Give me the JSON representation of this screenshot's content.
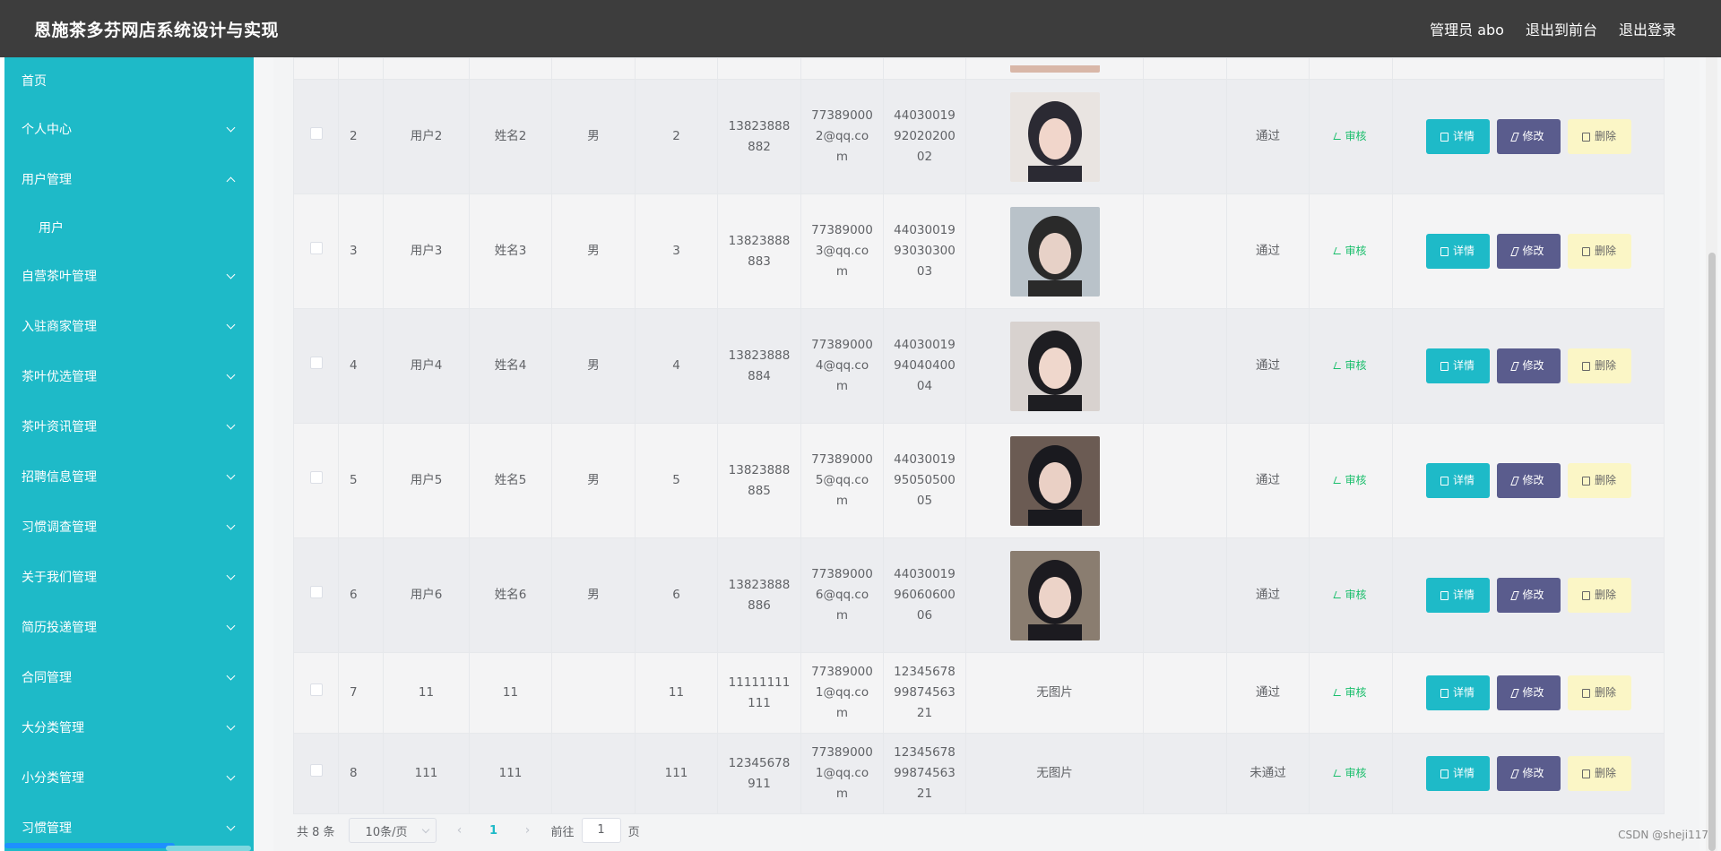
{
  "header": {
    "title": "恩施茶多芬网店系统设计与实现",
    "admin": "管理员 abo",
    "to_front": "退出到前台",
    "logout": "退出登录"
  },
  "sidebar": {
    "items": [
      {
        "label": "首页",
        "icon": "none"
      },
      {
        "label": "个人中心",
        "icon": "chevron-down-icon"
      },
      {
        "label": "用户管理",
        "icon": "chevron-up-icon"
      },
      {
        "label": "用户",
        "icon": "none"
      },
      {
        "label": "自营茶叶管理",
        "icon": "chevron-down-icon"
      },
      {
        "label": "入驻商家管理",
        "icon": "chevron-down-icon"
      },
      {
        "label": "茶叶优选管理",
        "icon": "chevron-down-icon"
      },
      {
        "label": "茶叶资讯管理",
        "icon": "chevron-down-icon"
      },
      {
        "label": "招聘信息管理",
        "icon": "chevron-down-icon"
      },
      {
        "label": "习惯调查管理",
        "icon": "chevron-down-icon"
      },
      {
        "label": "关于我们管理",
        "icon": "chevron-down-icon"
      },
      {
        "label": "简历投递管理",
        "icon": "chevron-down-icon"
      },
      {
        "label": "合同管理",
        "icon": "chevron-down-icon"
      },
      {
        "label": "大分类管理",
        "icon": "chevron-down-icon"
      },
      {
        "label": "小分类管理",
        "icon": "chevron-down-icon"
      },
      {
        "label": "习惯管理",
        "icon": "chevron-down-icon"
      }
    ]
  },
  "table": {
    "rows": [
      {
        "no": "2",
        "account": "用户2",
        "name": "姓名2",
        "gender": "男",
        "age": "2",
        "phone": [
          "13823888",
          "882"
        ],
        "email": [
          "77389000",
          "2@qq.co",
          "m"
        ],
        "idcard": [
          "44030019",
          "92020200",
          "02"
        ],
        "photo": "portrait-2",
        "status": "通过"
      },
      {
        "no": "3",
        "account": "用户3",
        "name": "姓名3",
        "gender": "男",
        "age": "3",
        "phone": [
          "13823888",
          "883"
        ],
        "email": [
          "77389000",
          "3@qq.co",
          "m"
        ],
        "idcard": [
          "44030019",
          "93030300",
          "03"
        ],
        "photo": "portrait-3",
        "status": "通过"
      },
      {
        "no": "4",
        "account": "用户4",
        "name": "姓名4",
        "gender": "男",
        "age": "4",
        "phone": [
          "13823888",
          "884"
        ],
        "email": [
          "77389000",
          "4@qq.co",
          "m"
        ],
        "idcard": [
          "44030019",
          "94040400",
          "04"
        ],
        "photo": "portrait-4",
        "status": "通过"
      },
      {
        "no": "5",
        "account": "用户5",
        "name": "姓名5",
        "gender": "男",
        "age": "5",
        "phone": [
          "13823888",
          "885"
        ],
        "email": [
          "77389000",
          "5@qq.co",
          "m"
        ],
        "idcard": [
          "44030019",
          "95050500",
          "05"
        ],
        "photo": "portrait-5",
        "status": "通过"
      },
      {
        "no": "6",
        "account": "用户6",
        "name": "姓名6",
        "gender": "男",
        "age": "6",
        "phone": [
          "13823888",
          "886"
        ],
        "email": [
          "77389000",
          "6@qq.co",
          "m"
        ],
        "idcard": [
          "44030019",
          "96060600",
          "06"
        ],
        "photo": "portrait-6",
        "status": "通过"
      },
      {
        "no": "7",
        "account": "11",
        "name": "11",
        "gender": "",
        "age": "11",
        "phone": [
          "11111111",
          "111"
        ],
        "email": [
          "77389000",
          "1@qq.co",
          "m"
        ],
        "idcard": [
          "12345678",
          "99874563",
          "21"
        ],
        "photo_text": "无图片",
        "status": "通过"
      },
      {
        "no": "8",
        "account": "111",
        "name": "111",
        "gender": "",
        "age": "111",
        "phone": [
          "12345678",
          "911"
        ],
        "email": [
          "77389000",
          "1@qq.co",
          "m"
        ],
        "idcard": [
          "12345678",
          "99874563",
          "21"
        ],
        "photo_text": "无图片",
        "status": "未通过"
      }
    ],
    "audit_label": "审核",
    "detail_label": "详情",
    "edit_label": "修改",
    "delete_label": "删除"
  },
  "pager": {
    "total": "共 8 条",
    "page_size": "10条/页",
    "current": "1",
    "goto_prefix": "前往",
    "goto_value": "1",
    "goto_suffix": "页"
  },
  "watermark": "CSDN @sheji117",
  "colors": {
    "accent": "#1ebac8",
    "header": "#3d3d3d",
    "edit": "#5a5c8d",
    "delete": "#fbf6c6",
    "audit": "#19be6b"
  }
}
